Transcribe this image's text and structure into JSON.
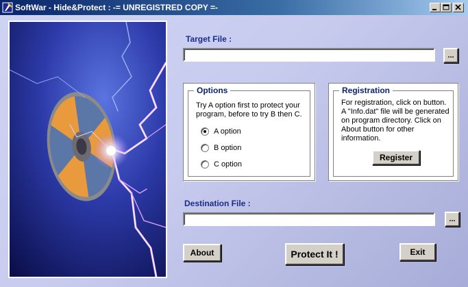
{
  "window": {
    "title": "SoftWar - Hide&Protect :  -= UNREGISTRED COPY  =-"
  },
  "target_file": {
    "label": "Target File  :",
    "value": "",
    "browse_label": "..."
  },
  "options": {
    "title": "Options",
    "description": "Try A option first to protect your program, before to try B then C.",
    "items": [
      {
        "label": "A option",
        "checked": true
      },
      {
        "label": "B option",
        "checked": false
      },
      {
        "label": "C option",
        "checked": false
      }
    ]
  },
  "registration": {
    "title": "Registration",
    "description": "For registration, click on button. A \"Info.dat\" file will be generated on program directory. Click on About button for other information.",
    "button_label": "Register"
  },
  "destination_file": {
    "label": "Destination File :",
    "value": "",
    "browse_label": "..."
  },
  "actions": {
    "about_label": "About",
    "protect_label": "Protect It !",
    "exit_label": "Exit"
  },
  "icons": {
    "app": "app-icon",
    "minimize": "minimize-icon",
    "maximize": "maximize-icon",
    "close": "close-icon",
    "art": "disc-lightning-image"
  }
}
